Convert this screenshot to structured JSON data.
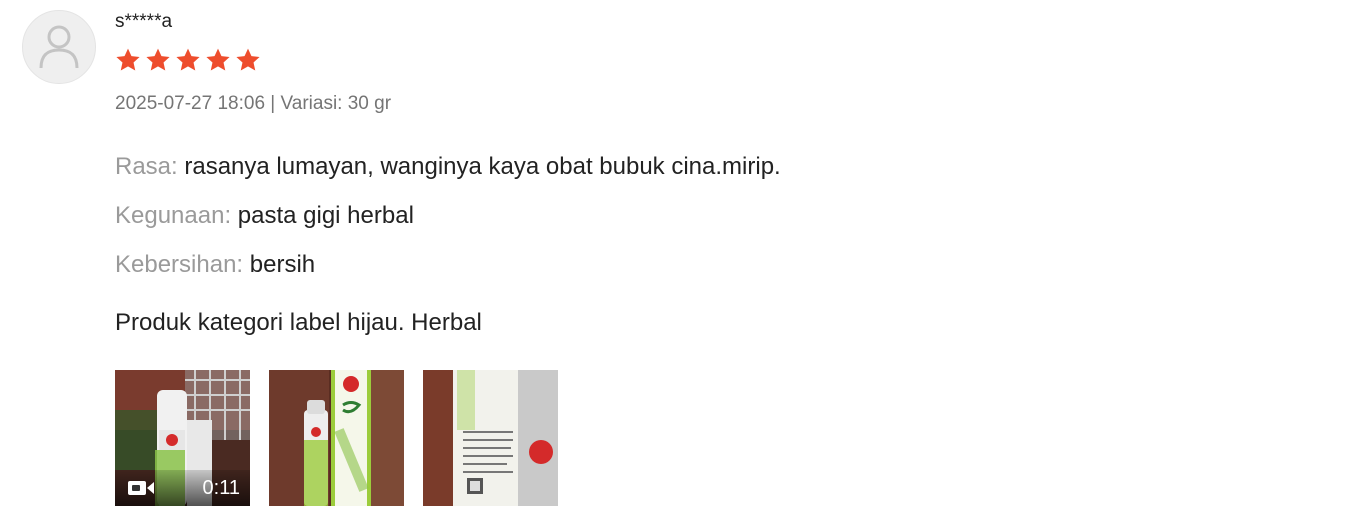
{
  "review": {
    "username": "s*****a",
    "rating": 5,
    "star_color": "#ee4d2d",
    "meta": "2025-07-27 18:06 | Variasi: 30 gr",
    "attributes": [
      {
        "key": "Rasa:",
        "value": " rasanya lumayan, wanginya kaya obat bubuk cina.mirip."
      },
      {
        "key": "Kegunaan:",
        "value": " pasta gigi herbal"
      },
      {
        "key": "Kebersihan:",
        "value": " bersih"
      }
    ],
    "comment": "Produk kategori label hijau. Herbal",
    "media": [
      {
        "type": "video",
        "duration": "0:11",
        "icon": "video-camera-icon"
      },
      {
        "type": "image"
      },
      {
        "type": "image"
      }
    ]
  }
}
